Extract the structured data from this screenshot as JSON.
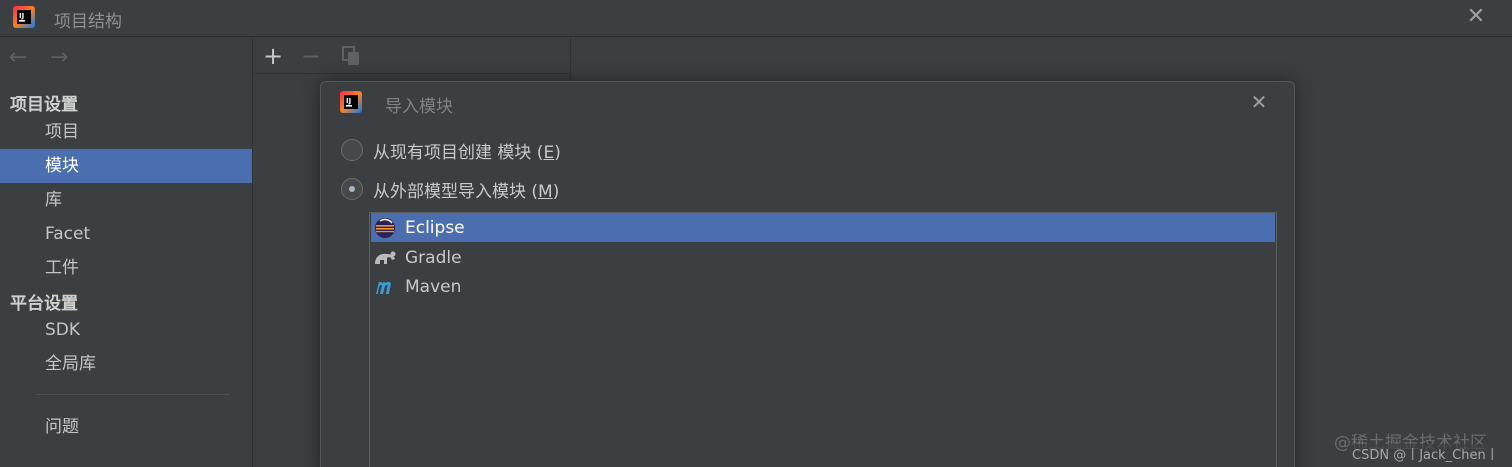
{
  "window": {
    "title": "项目结构",
    "close_icon": "close-icon"
  },
  "sidebar": {
    "back_icon": "arrow-left-icon",
    "forward_icon": "arrow-right-icon",
    "section_project": "项目设置",
    "items_project": [
      {
        "label": "项目"
      },
      {
        "label": "模块",
        "selected": true
      },
      {
        "label": "库"
      },
      {
        "label": "Facet"
      },
      {
        "label": "工件"
      }
    ],
    "section_platform": "平台设置",
    "items_platform": [
      {
        "label": "SDK"
      },
      {
        "label": "全局库"
      }
    ],
    "problems": "问题"
  },
  "toolbar": {
    "add": "+",
    "remove": "−",
    "copy_icon": "copy-icon"
  },
  "dialog": {
    "title": "导入模块",
    "option_create": {
      "text": "从现有项目创建 模块 (",
      "mnemonic": "E",
      "suffix": ")",
      "checked": false
    },
    "option_import": {
      "text": "从外部模型导入模块 (",
      "mnemonic": "M",
      "suffix": ")",
      "checked": true
    },
    "models": [
      {
        "label": "Eclipse",
        "icon": "eclipse-icon",
        "selected": true
      },
      {
        "label": "Gradle",
        "icon": "gradle-icon",
        "selected": false
      },
      {
        "label": "Maven",
        "icon": "maven-icon",
        "selected": false
      }
    ]
  },
  "watermark": {
    "line1": "@稀土掘金技术社区",
    "line2": "CSDN @丨Jack_Chen丨"
  },
  "colors": {
    "background": "#3c3f41",
    "selection": "#4b6eaf",
    "text": "#bbbbbb"
  }
}
